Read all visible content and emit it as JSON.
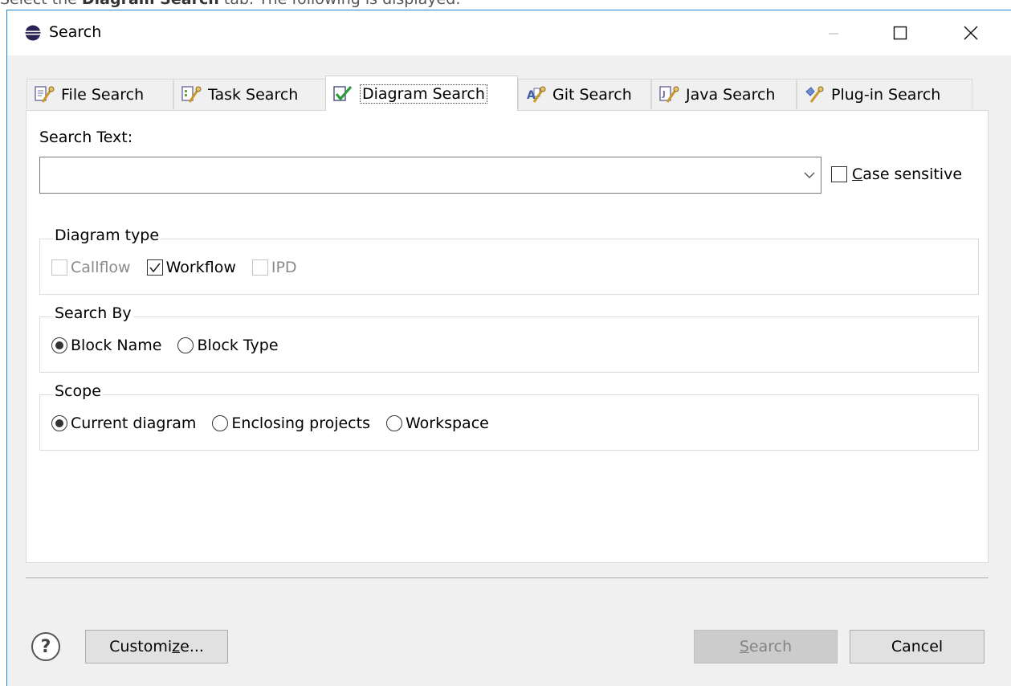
{
  "intro": {
    "prefix": "Select the ",
    "bold": "Diagram Search",
    "suffix": " tab. The following is displayed:"
  },
  "window": {
    "title": "Search",
    "controls": [
      "minimize",
      "maximize",
      "close"
    ]
  },
  "tabs": [
    {
      "label": "File Search",
      "icon": "file-search-icon",
      "active": false
    },
    {
      "label": "Task Search",
      "icon": "task-search-icon",
      "active": false
    },
    {
      "label": "Diagram Search",
      "icon": "diagram-search-icon",
      "active": true
    },
    {
      "label": "Git Search",
      "icon": "git-search-icon",
      "active": false
    },
    {
      "label": "Java Search",
      "icon": "java-search-icon",
      "active": false
    },
    {
      "label": "Plug-in Search",
      "icon": "plugin-search-icon",
      "active": false
    }
  ],
  "search_text": {
    "label": "Search Text:",
    "value": "",
    "case_sensitive": {
      "mnemonic": "C",
      "rest": "ase sensitive",
      "checked": false
    }
  },
  "diagram_type": {
    "title": "Diagram type",
    "options": [
      {
        "label": "Callflow",
        "checked": false,
        "enabled": false
      },
      {
        "label": "Workflow",
        "checked": true,
        "enabled": true
      },
      {
        "label": "IPD",
        "checked": false,
        "enabled": false
      }
    ]
  },
  "search_by": {
    "title": "Search By",
    "options": [
      {
        "label": "Block Name",
        "selected": true
      },
      {
        "label": "Block Type",
        "selected": false
      }
    ]
  },
  "scope": {
    "title": "Scope",
    "options": [
      {
        "label": "Current diagram",
        "selected": true
      },
      {
        "label": "Enclosing projects",
        "selected": false
      },
      {
        "label": "Workspace",
        "selected": false
      }
    ]
  },
  "buttons": {
    "help": "?",
    "customize": {
      "before": "Customi",
      "mnemonic": "z",
      "after": "e..."
    },
    "search": {
      "mnemonic": "S",
      "rest": "earch",
      "enabled": false
    },
    "cancel": "Cancel"
  },
  "colors": {
    "window_border": "#1883d7",
    "dialog_bg": "#f0f0f0",
    "check_green": "#2e9a3e"
  }
}
